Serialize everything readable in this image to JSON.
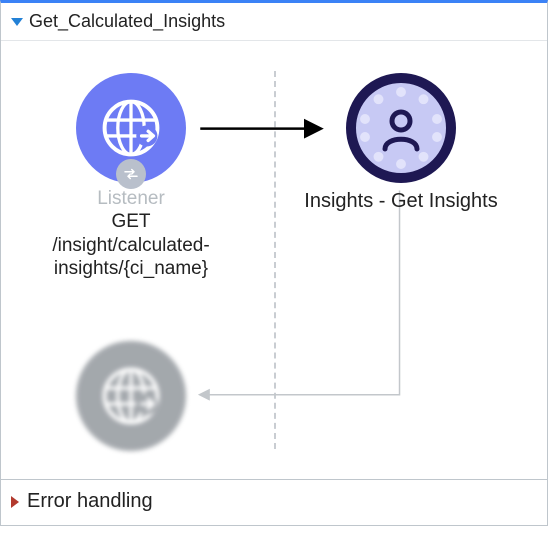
{
  "panel": {
    "title": "Get_Calculated_Insights",
    "expanded": true
  },
  "nodes": {
    "listener": {
      "title": "Listener",
      "subtitle": "GET /insight/calculated-insights/{ci_name}"
    },
    "insights": {
      "title": "Insights - Get Insights"
    },
    "response": {
      "title": ""
    }
  },
  "footer": {
    "title": "Error handling",
    "expanded": false
  },
  "icons": {
    "globe": "globe-arrow-icon",
    "swap": "swap-icon",
    "user": "user-circle-icon"
  }
}
